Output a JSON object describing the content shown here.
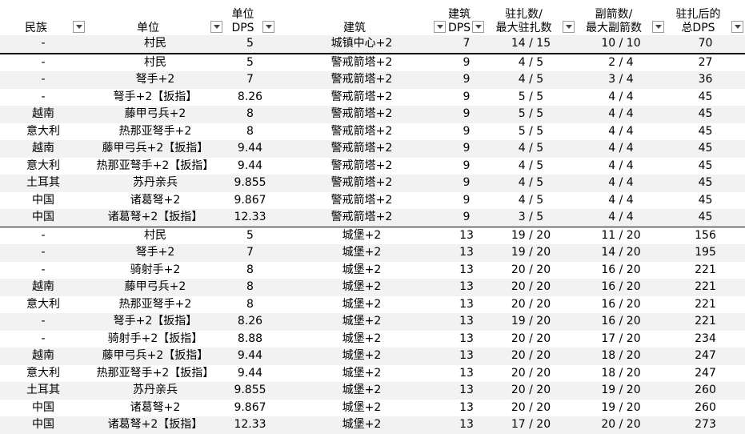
{
  "headers": [
    {
      "line1": "",
      "line2": "民族"
    },
    {
      "line1": "",
      "line2": "单位"
    },
    {
      "line1": "单位",
      "line2": "DPS"
    },
    {
      "line1": "",
      "line2": "建筑"
    },
    {
      "line1": "建筑",
      "line2": "DPS"
    },
    {
      "line1": "驻扎数/",
      "line2": "最大驻扎数"
    },
    {
      "line1": "副箭数/",
      "line2": "最大副箭数"
    },
    {
      "line1": "驻扎后的",
      "line2": "总DPS"
    }
  ],
  "filter_icon": "chevron-down-icon",
  "rows": [
    [
      "-",
      "村民",
      "5",
      "城镇中心+2",
      "7",
      "14 / 15",
      "10 / 10",
      "70"
    ],
    [
      "-",
      "村民",
      "5",
      "警戒箭塔+2",
      "9",
      "4 / 5",
      "2 / 4",
      "27"
    ],
    [
      "-",
      "弩手+2",
      "7",
      "警戒箭塔+2",
      "9",
      "4 / 5",
      "3 / 4",
      "36"
    ],
    [
      "-",
      "弩手+2【扳指】",
      "8.26",
      "警戒箭塔+2",
      "9",
      "5 / 5",
      "4 / 4",
      "45"
    ],
    [
      "越南",
      "藤甲弓兵+2",
      "8",
      "警戒箭塔+2",
      "9",
      "5 / 5",
      "4 / 4",
      "45"
    ],
    [
      "意大利",
      "热那亚弩手+2",
      "8",
      "警戒箭塔+2",
      "9",
      "5 / 5",
      "4 / 4",
      "45"
    ],
    [
      "越南",
      "藤甲弓兵+2【扳指】",
      "9.44",
      "警戒箭塔+2",
      "9",
      "4 / 5",
      "4 / 4",
      "45"
    ],
    [
      "意大利",
      "热那亚弩手+2【扳指】",
      "9.44",
      "警戒箭塔+2",
      "9",
      "4 / 5",
      "4 / 4",
      "45"
    ],
    [
      "土耳其",
      "苏丹亲兵",
      "9.855",
      "警戒箭塔+2",
      "9",
      "4 / 5",
      "4 / 4",
      "45"
    ],
    [
      "中国",
      "诸葛弩+2",
      "9.867",
      "警戒箭塔+2",
      "9",
      "4 / 5",
      "4 / 4",
      "45"
    ],
    [
      "中国",
      "诸葛弩+2【扳指】",
      "12.33",
      "警戒箭塔+2",
      "9",
      "3 / 5",
      "4 / 4",
      "45"
    ],
    [
      "-",
      "村民",
      "5",
      "城堡+2",
      "13",
      "19 / 20",
      "11 / 20",
      "156"
    ],
    [
      "-",
      "弩手+2",
      "7",
      "城堡+2",
      "13",
      "19 / 20",
      "14 / 20",
      "195"
    ],
    [
      "-",
      "骑射手+2",
      "8",
      "城堡+2",
      "13",
      "20 / 20",
      "16 / 20",
      "221"
    ],
    [
      "越南",
      "藤甲弓兵+2",
      "8",
      "城堡+2",
      "13",
      "20 / 20",
      "16 / 20",
      "221"
    ],
    [
      "意大利",
      "热那亚弩手+2",
      "8",
      "城堡+2",
      "13",
      "20 / 20",
      "16 / 20",
      "221"
    ],
    [
      "-",
      "弩手+2【扳指】",
      "8.26",
      "城堡+2",
      "13",
      "19 / 20",
      "16 / 20",
      "221"
    ],
    [
      "-",
      "骑射手+2【扳指】",
      "8.88",
      "城堡+2",
      "13",
      "20 / 20",
      "17 / 20",
      "234"
    ],
    [
      "越南",
      "藤甲弓兵+2【扳指】",
      "9.44",
      "城堡+2",
      "13",
      "20 / 20",
      "18 / 20",
      "247"
    ],
    [
      "意大利",
      "热那亚弩手+2【扳指】",
      "9.44",
      "城堡+2",
      "13",
      "20 / 20",
      "18 / 20",
      "247"
    ],
    [
      "土耳其",
      "苏丹亲兵",
      "9.855",
      "城堡+2",
      "13",
      "20 / 20",
      "19 / 20",
      "260"
    ],
    [
      "中国",
      "诸葛弩+2",
      "9.867",
      "城堡+2",
      "13",
      "20 / 20",
      "19 / 20",
      "260"
    ],
    [
      "中国",
      "诸葛弩+2【扳指】",
      "12.33",
      "城堡+2",
      "13",
      "17 / 20",
      "20 / 20",
      "273"
    ]
  ]
}
